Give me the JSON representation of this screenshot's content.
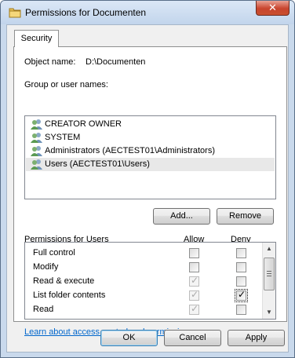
{
  "window": {
    "title": "Permissions for Documenten",
    "close_glyph": "✕"
  },
  "tabs": [
    {
      "label": "Security"
    }
  ],
  "object": {
    "label": "Object name:",
    "value": "D:\\Documenten"
  },
  "groups": {
    "label": "Group or user names:",
    "items": [
      {
        "name": "CREATOR OWNER",
        "selected": false
      },
      {
        "name": "SYSTEM",
        "selected": false
      },
      {
        "name": "Administrators (AECTEST01\\Administrators)",
        "selected": false
      },
      {
        "name": "Users (AECTEST01\\Users)",
        "selected": true
      }
    ]
  },
  "buttons": {
    "add": "Add...",
    "remove": "Remove",
    "ok": "OK",
    "cancel": "Cancel",
    "apply": "Apply"
  },
  "permissions": {
    "label": "Permissions for Users",
    "allow_header": "Allow",
    "deny_header": "Deny",
    "rows": [
      {
        "name": "Full control",
        "allow": false,
        "allow_disabled": false,
        "deny": false
      },
      {
        "name": "Modify",
        "allow": false,
        "allow_disabled": false,
        "deny": false
      },
      {
        "name": "Read & execute",
        "allow": true,
        "allow_disabled": true,
        "deny": false
      },
      {
        "name": "List folder contents",
        "allow": true,
        "allow_disabled": true,
        "deny": true
      },
      {
        "name": "Read",
        "allow": true,
        "allow_disabled": true,
        "deny": false
      },
      {
        "name": "",
        "allow": true,
        "allow_disabled": true,
        "deny": false
      }
    ]
  },
  "link": {
    "text": "Learn about access control and permissions"
  },
  "icons": {
    "folder": "folder-icon",
    "user_group": "user-group-icon",
    "scroll_up": "scroll-up-arrow-icon",
    "scroll_down": "scroll-down-arrow-icon"
  },
  "colors": {
    "link": "#0066cc",
    "close": "#c8442e",
    "selection": "#e8e8e8"
  }
}
